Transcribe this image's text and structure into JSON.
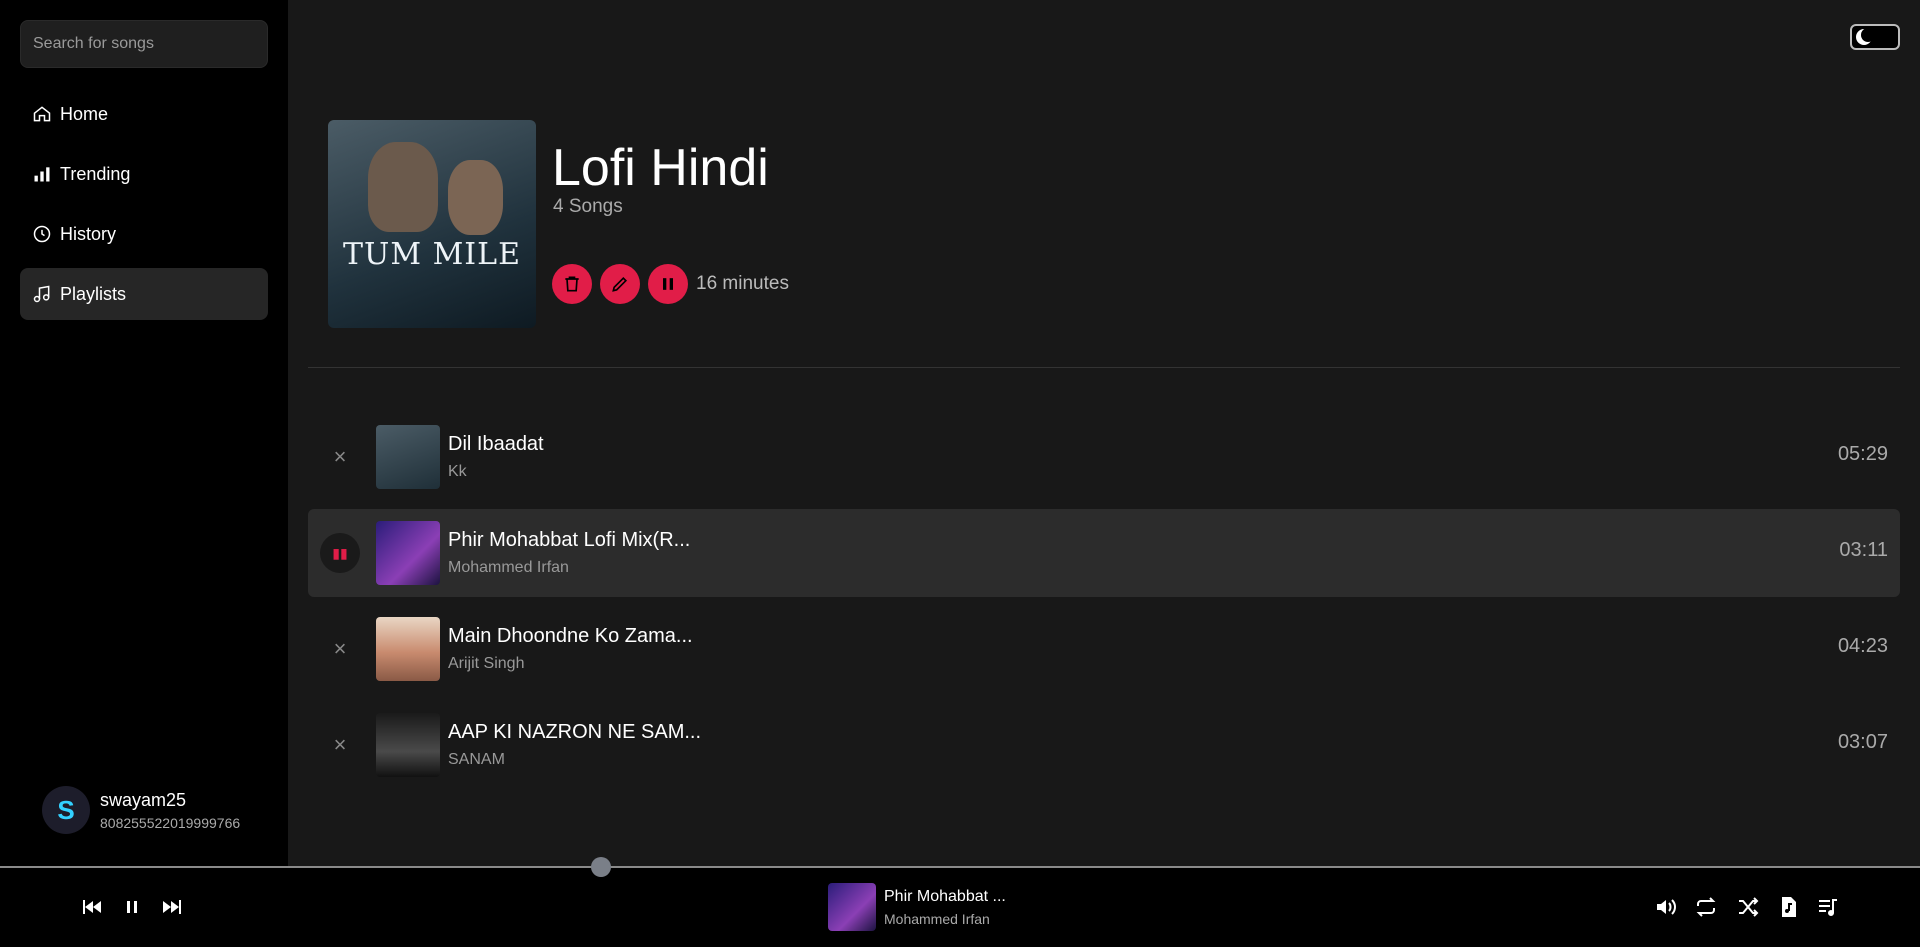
{
  "search": {
    "placeholder": "Search for songs"
  },
  "nav": {
    "items": [
      {
        "label": "Home",
        "icon": "home-icon"
      },
      {
        "label": "Trending",
        "icon": "bar-chart-icon"
      },
      {
        "label": "History",
        "icon": "history-icon"
      },
      {
        "label": "Playlists",
        "icon": "music-note-icon",
        "active": true
      }
    ]
  },
  "user": {
    "initial": "S",
    "name": "swayam25",
    "id": "808255522019999766"
  },
  "playlist": {
    "title": "Lofi Hindi",
    "song_count": "4 Songs",
    "duration": "16 minutes",
    "cover_text": "TUM MILE"
  },
  "songs": [
    {
      "title": "Dil Ibaadat",
      "artist": "Kk",
      "time": "05:29",
      "active": false
    },
    {
      "title": "Phir Mohabbat Lofi Mix(R...",
      "artist": "Mohammed Irfan",
      "time": "03:11",
      "active": true
    },
    {
      "title": "Main Dhoondne Ko Zama...",
      "artist": "Arijit Singh",
      "time": "04:23",
      "active": false
    },
    {
      "title": "AAP KI NAZRON NE SAM...",
      "artist": "SANAM",
      "time": "03:07",
      "active": false
    }
  ],
  "now_playing": {
    "title": "Phir Mohabbat ...",
    "artist": "Mohammed Irfan",
    "progress": 0.31
  },
  "colors": {
    "accent": "#e11d48",
    "sidebar": "#000000",
    "main": "#181818"
  }
}
